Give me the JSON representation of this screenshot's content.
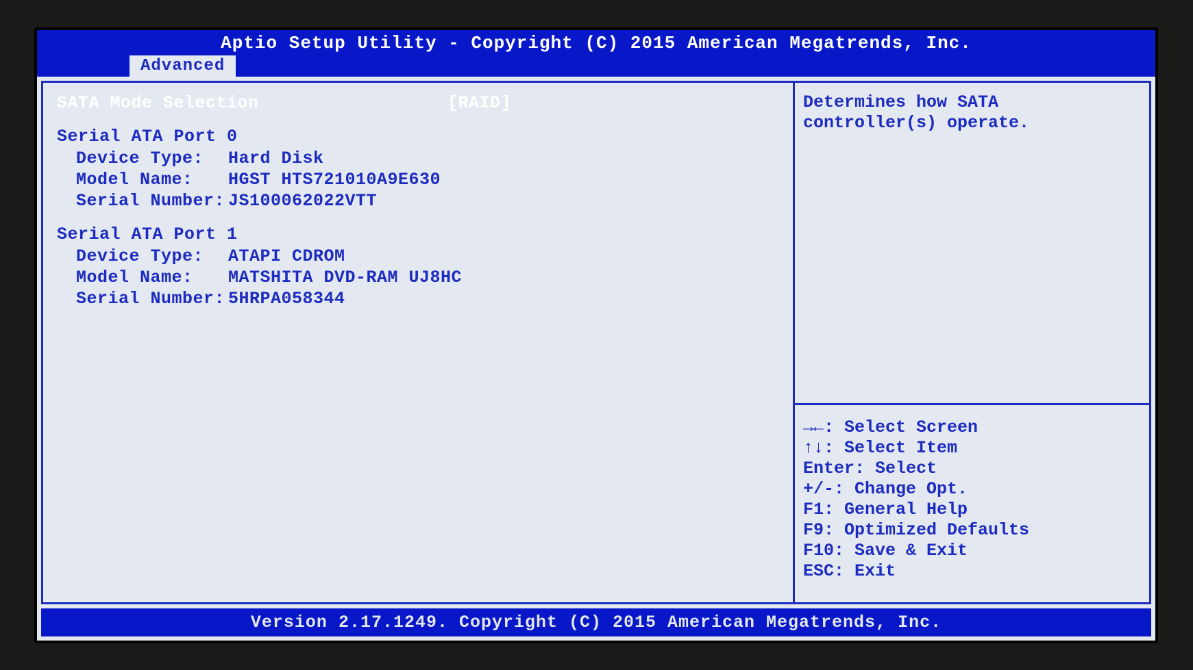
{
  "header": {
    "title": "Aptio Setup Utility - Copyright (C) 2015 American Megatrends, Inc.",
    "tab": "Advanced"
  },
  "main": {
    "selected": {
      "label": "SATA Mode Selection",
      "value": "[RAID]"
    },
    "port0": {
      "title": "Serial ATA Port 0",
      "device_type_label": "Device Type:",
      "device_type": "Hard Disk",
      "model_label": "Model Name:",
      "model": "HGST HTS721010A9E630",
      "serial_label": "Serial Number:",
      "serial": "JS100062022VTT"
    },
    "port1": {
      "title": "Serial ATA Port 1",
      "device_type_label": "Device Type:",
      "device_type": "ATAPI CDROM",
      "model_label": "Model Name:",
      "model": "MATSHITA DVD-RAM UJ8HC",
      "serial_label": "Serial Number:",
      "serial": "5HRPA058344"
    }
  },
  "help": {
    "description": "Determines how SATA controller(s) operate.",
    "keys": {
      "screen": "→←: Select Screen",
      "item": "↑↓: Select Item",
      "enter": "Enter: Select",
      "change": "+/-: Change Opt.",
      "f1": "F1: General Help",
      "f9": "F9: Optimized Defaults",
      "f10": "F10: Save & Exit",
      "esc": "ESC: Exit"
    }
  },
  "footer": {
    "text": "Version 2.17.1249. Copyright (C) 2015 American Megatrends, Inc."
  }
}
